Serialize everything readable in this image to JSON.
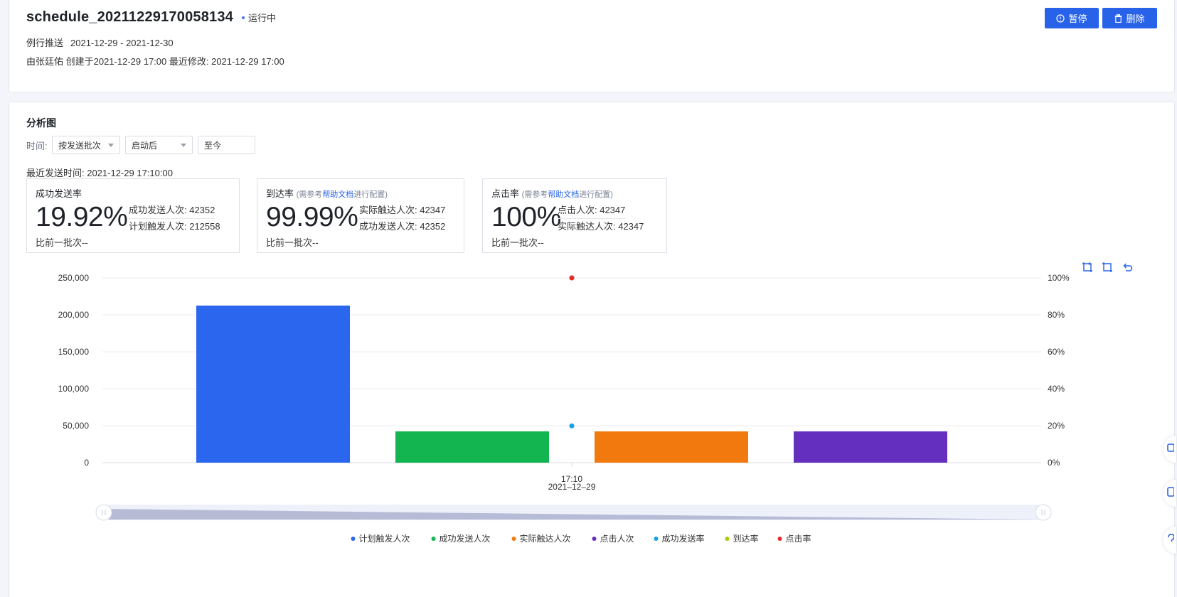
{
  "header": {
    "title": "schedule_20211229170058134",
    "status": "运行中",
    "push_type": "例行推送",
    "date_range": "2021-12-29 - 2021-12-30",
    "creator_line": "由张廷佑 创建于2021-12-29 17:00 最近修改: 2021-12-29 17:00",
    "pause_label": "暂停",
    "delete_label": "删除"
  },
  "analysis": {
    "section_title": "分析图",
    "time_label": "时间:",
    "selects": {
      "batch": "按发送批次",
      "after": "启动后",
      "until": "至今"
    },
    "last_send": "最近发送时间: 2021-12-29 17:10:00",
    "metrics": [
      {
        "title": "成功发送率",
        "hint_prefix": "",
        "hint_link": "",
        "hint_suffix": "",
        "value": "19.92%",
        "detail_1": "成功发送人次: 42352",
        "detail_2": "计划触发人次: 212558",
        "compare": "比前一批次--"
      },
      {
        "title": "到达率",
        "hint_prefix": "(需参考",
        "hint_link": "帮助文档",
        "hint_suffix": "进行配置)",
        "value": "99.99%",
        "detail_1": "实际触达人次: 42347",
        "detail_2": "成功发送人次: 42352",
        "compare": "比前一批次--"
      },
      {
        "title": "点击率",
        "hint_prefix": "(需参考",
        "hint_link": "帮助文档",
        "hint_suffix": "进行配置)",
        "value": "100%",
        "detail_1": "点击人次: 42347",
        "detail_2": "实际触达人次: 42347",
        "compare": "比前一批次--"
      }
    ],
    "toolbox": [
      "zoom-select-icon",
      "zoom-reset-icon",
      "restore-icon"
    ]
  },
  "chart_data": {
    "type": "bar",
    "x_time": "17:10",
    "x_date": "2021–12–29",
    "y_left_ticks": [
      "250,000",
      "200,000",
      "150,000",
      "100,000",
      "50,000",
      "0"
    ],
    "y_right_ticks": [
      "100%",
      "80%",
      "60%",
      "40%",
      "20%",
      "0%"
    ],
    "ylim_left": [
      0,
      250000
    ],
    "ylim_right": [
      0,
      100
    ],
    "bar_series": [
      {
        "name": "计划触发人次",
        "value": 212558,
        "color": "#2a67ee"
      },
      {
        "name": "成功发送人次",
        "value": 42352,
        "color": "#12b54f"
      },
      {
        "name": "实际触达人次",
        "value": 42347,
        "color": "#f2790e"
      },
      {
        "name": "点击人次",
        "value": 42347,
        "color": "#642fbe"
      }
    ],
    "line_series": [
      {
        "name": "成功发送率",
        "value": 19.92,
        "color": "#14a0ea"
      },
      {
        "name": "到达率",
        "value": 99.99,
        "color": "#a8cc10"
      },
      {
        "name": "点击率",
        "value": 100,
        "color": "#e8292b"
      }
    ],
    "legend_position": "bottom-center",
    "grid": true
  }
}
